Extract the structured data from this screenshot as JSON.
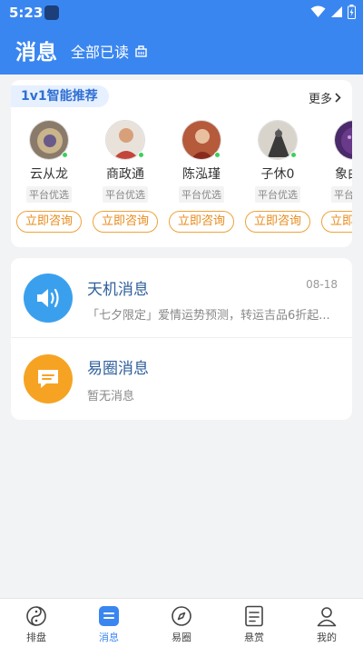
{
  "status_bar": {
    "time": "5:23",
    "icons": [
      "app-icon",
      "wifi-icon",
      "signal-icon",
      "battery-icon"
    ]
  },
  "header": {
    "title": "消息",
    "mark_all_read": "全部已读",
    "mark_icon": "clear-icon"
  },
  "recommend": {
    "title": "1v1智能推荐",
    "more": "更多",
    "experts": [
      {
        "name": "云从龙",
        "tag": "平台优选",
        "button": "立即咨询",
        "online": true,
        "avatar_color": "#8a7a6a"
      },
      {
        "name": "商政通",
        "tag": "平台优选",
        "button": "立即咨询",
        "online": true,
        "avatar_color": "#c2463a"
      },
      {
        "name": "陈泓瑾",
        "tag": "平台优选",
        "button": "立即咨询",
        "online": true,
        "avatar_color": "#b65a3c"
      },
      {
        "name": "子休0",
        "tag": "平台优选",
        "button": "立即咨询",
        "online": true,
        "avatar_color": "#5a5a5a"
      },
      {
        "name": "象由心",
        "tag": "平台优选",
        "button": "立即咨询",
        "online": false,
        "avatar_color": "#6a3a8a"
      }
    ]
  },
  "messages": [
    {
      "title": "天机消息",
      "time": "08-18",
      "preview": "「七夕限定」爱情运势预测，转运吉品6折起...",
      "icon": "speaker-icon",
      "color": "#3aa0ee"
    },
    {
      "title": "易圈消息",
      "time": "",
      "preview": "暂无消息",
      "icon": "chat-icon",
      "color": "#f6a323"
    }
  ],
  "tabs": [
    {
      "label": "排盘",
      "icon": "yin-yang-icon",
      "active": false
    },
    {
      "label": "消息",
      "icon": "message-icon",
      "active": true
    },
    {
      "label": "易圈",
      "icon": "compass-icon",
      "active": false
    },
    {
      "label": "悬赏",
      "icon": "reward-icon",
      "active": false
    },
    {
      "label": "我的",
      "icon": "profile-icon",
      "active": false
    }
  ],
  "colors": {
    "primary": "#3a86f0",
    "accent_orange": "#f0a23a",
    "online": "#3cd05a"
  }
}
